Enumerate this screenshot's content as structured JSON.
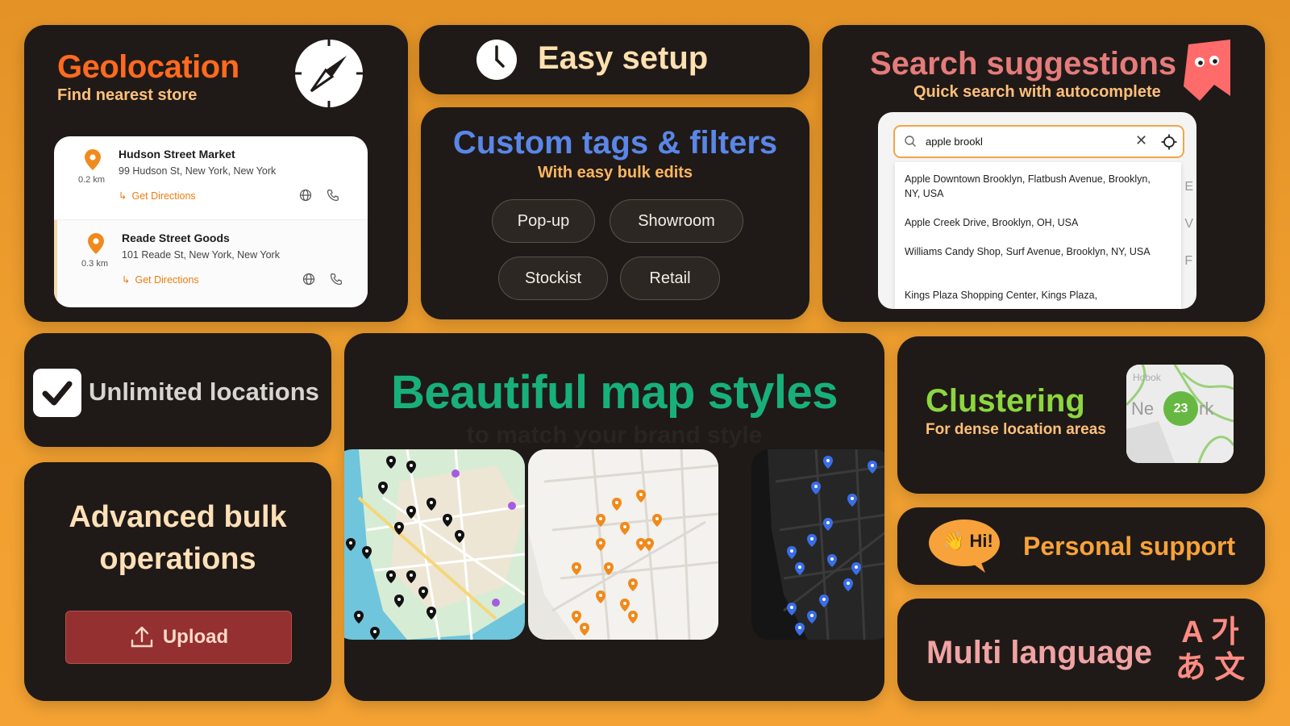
{
  "geolocation": {
    "title": "Geolocation",
    "subtitle": "Find nearest store",
    "stores": [
      {
        "name": "Hudson Street Market",
        "address": "99 Hudson St, New York, New York",
        "distance": "0.2 km",
        "directions": "Get Directions"
      },
      {
        "name": "Reade Street Goods",
        "address": "101 Reade St, New York, New York",
        "distance": "0.3 km",
        "directions": "Get Directions"
      }
    ],
    "icons": [
      "compass-icon",
      "map-pin-icon",
      "globe-icon",
      "phone-icon",
      "turn-arrow-icon"
    ],
    "accent": "#ff6a1f"
  },
  "easy_setup": {
    "title": "Easy setup",
    "icon": "clock-icon"
  },
  "tags": {
    "title": "Custom tags & filters",
    "subtitle": "With easy bulk edits",
    "items": [
      "Pop-up",
      "Showroom",
      "Stockist",
      "Retail"
    ],
    "accent": "#5a86e8"
  },
  "search": {
    "title": "Search suggestions",
    "subtitle": "Quick search with autocomplete",
    "input_value": "apple brookl",
    "suggestions": [
      "Apple Downtown Brooklyn, Flatbush Avenue, Brooklyn, NY, USA",
      "Apple Creek Drive, Brooklyn, OH, USA",
      "Williams Candy Shop, Surf Avenue, Brooklyn, NY, USA",
      "Kings Plaza Shopping Center, Kings Plaza,"
    ],
    "icons": [
      "search-icon",
      "clear-icon",
      "locate-icon",
      "mascot-icon"
    ]
  },
  "unlimited": {
    "title": "Unlimited locations",
    "icon": "checkbox-icon"
  },
  "bulk": {
    "title_line1": "Advanced bulk",
    "title_line2": "operations",
    "button": "Upload",
    "icon": "upload-icon"
  },
  "maps": {
    "title": "Beautiful map styles",
    "ghost_subtitle": "to match your brand style",
    "styles": [
      "color",
      "light",
      "dark"
    ],
    "pin_colors": {
      "color": "#111111",
      "light": "#f08a1c",
      "dark": "#3a6ee8"
    }
  },
  "clustering": {
    "title": "Clustering",
    "subtitle": "For dense location areas",
    "cluster_count": "23",
    "accent": "#8dd640"
  },
  "support": {
    "title": "Personal support",
    "bubble": "👋 Hi!"
  },
  "language": {
    "title": "Multi language",
    "glyphs_line1": "A 가",
    "glyphs_line2": "あ 文"
  }
}
